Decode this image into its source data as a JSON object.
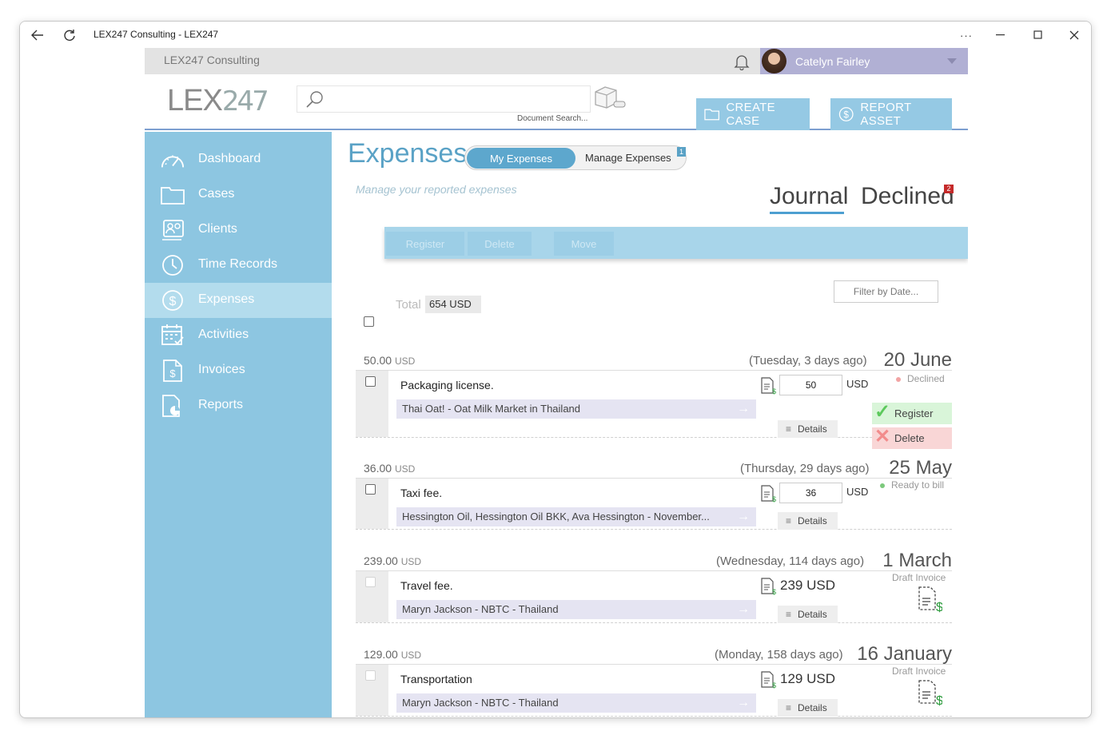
{
  "window": {
    "title": "LEX247 Consulting - LEX247"
  },
  "topbar": {
    "company": "LEX247 Consulting",
    "user": "Catelyn Fairley"
  },
  "header": {
    "logo": "LEX247",
    "logo_main": "LEX",
    "logo_num": "247",
    "search_placeholder": "",
    "search_hint": "Document Search...",
    "create_case": "CREATE CASE",
    "report_asset": "REPORT ASSET"
  },
  "sidebar": {
    "items": [
      {
        "label": "Dashboard",
        "icon": "dashboard-icon"
      },
      {
        "label": "Cases",
        "icon": "folder-icon"
      },
      {
        "label": "Clients",
        "icon": "clients-icon"
      },
      {
        "label": "Time Records",
        "icon": "clock-icon"
      },
      {
        "label": "Expenses",
        "icon": "dollar-circle-icon",
        "active": true
      },
      {
        "label": "Activities",
        "icon": "calendar-icon"
      },
      {
        "label": "Invoices",
        "icon": "invoice-icon"
      },
      {
        "label": "Reports",
        "icon": "report-icon"
      }
    ]
  },
  "page": {
    "title": "Expenses",
    "toggle_my": "My Expenses",
    "toggle_manage": "Manage Expenses",
    "toggle_badge": "1",
    "subtitle": "Manage your reported expenses",
    "tab_journal": "Journal",
    "tab_declined": "Declined",
    "declined_badge": "2",
    "actions": {
      "register": "Register",
      "delete": "Delete",
      "move": "Move"
    },
    "filter": "Filter by Date...",
    "total_label": "Total",
    "total_value": "654 USD"
  },
  "expenses": [
    {
      "amount": "50.00",
      "currency": "USD",
      "relative": "(Tuesday, 3 days ago)",
      "date": "20 June",
      "description": "Packaging license.",
      "client": "Thai Oat! - Oat Milk Market in Thailand",
      "input_value": "50",
      "input_currency": "USD",
      "status": "Declined",
      "status_color": "#f2a4a4",
      "register": "Register",
      "delete": "Delete",
      "details": "Details"
    },
    {
      "amount": "36.00",
      "currency": "USD",
      "relative": "(Thursday, 29 days ago)",
      "date": "25 May",
      "description": "Taxi fee.",
      "client": "Hessington Oil, Hessington Oil BKK, Ava Hessington - November...",
      "input_value": "36",
      "input_currency": "USD",
      "status": "Ready to bill",
      "status_color": "#7cc97c",
      "details": "Details"
    },
    {
      "amount": "239.00",
      "currency": "USD",
      "relative": "(Wednesday, 114 days ago)",
      "date": "1 March",
      "description": "Travel fee.",
      "client": "Maryn Jackson - NBTC - Thailand",
      "display_amount": "239 USD",
      "status": "Draft Invoice",
      "details": "Details"
    },
    {
      "amount": "129.00",
      "currency": "USD",
      "relative": "(Monday, 158 days ago)",
      "date": "16 January",
      "description": "Transportation",
      "client": "Maryn Jackson - NBTC - Thailand",
      "display_amount": "129 USD",
      "status": "Draft Invoice",
      "details": "Details"
    }
  ],
  "colors": {
    "sidebar": "#8dc6e1",
    "sidebar_active": "#b3dced",
    "accent": "#5aa2c6",
    "user_bar": "#b1b0d4"
  }
}
